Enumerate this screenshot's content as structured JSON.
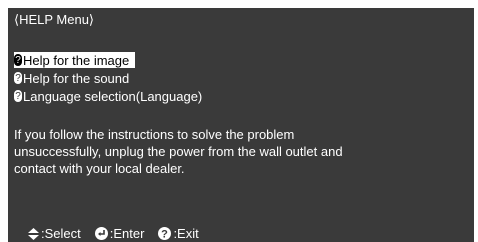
{
  "menu_title": "⟨HELP Menu⟩",
  "items": [
    {
      "label": "Help for the image",
      "selected": true
    },
    {
      "label": "Help for the sound",
      "selected": false
    },
    {
      "label": "Language selection(Language)",
      "selected": false
    }
  ],
  "message_lines": [
    "If you follow the instructions to solve the problem",
    "unsuccessfully, unplug the power from the wall outlet and",
    "contact with your local dealer."
  ],
  "footer": {
    "select_label": ":Select",
    "enter_label": ":Enter",
    "exit_label": ":Exit"
  },
  "icons": {
    "item_icon": "help-question-icon",
    "select_icon": "up-down-arrows-icon",
    "enter_icon": "enter-icon",
    "exit_icon": "help-icon"
  },
  "colors": {
    "background": "#3a3a3a",
    "text": "#ffffff",
    "highlight": "#ffffff"
  }
}
